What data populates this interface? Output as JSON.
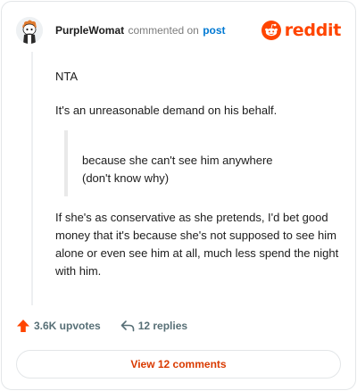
{
  "header": {
    "username": "PurpleWomat",
    "action_text": "commented on",
    "target": "post",
    "logo_text": "reddit",
    "avatar_icon": "snoo-avatar",
    "brand_color": "#ff4500"
  },
  "comment": {
    "paragraph_1": "NTA",
    "paragraph_2": "It's an unreasonable demand on his behalf.",
    "quote_line_1": "because she can't see him anywhere",
    "quote_line_2": "(don't know why)",
    "paragraph_3": "If she's as conservative as she pretends, I'd bet good money that it's because she's not supposed to see him alone or even see him at all, much less spend the night with him."
  },
  "actions": {
    "upvotes_label": "3.6K upvotes",
    "replies_label": "12 replies",
    "view_button_label": "View 12 comments",
    "upvote_color": "#ff4500",
    "link_color": "#d93a00"
  }
}
